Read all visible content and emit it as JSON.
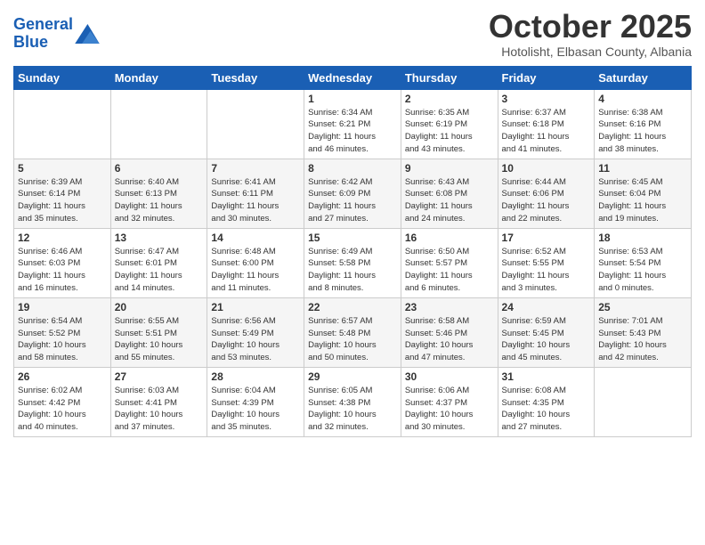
{
  "header": {
    "logo_line1": "General",
    "logo_line2": "Blue",
    "month": "October 2025",
    "location": "Hotolisht, Elbasan County, Albania"
  },
  "weekdays": [
    "Sunday",
    "Monday",
    "Tuesday",
    "Wednesday",
    "Thursday",
    "Friday",
    "Saturday"
  ],
  "weeks": [
    [
      {
        "day": "",
        "info": ""
      },
      {
        "day": "",
        "info": ""
      },
      {
        "day": "",
        "info": ""
      },
      {
        "day": "1",
        "info": "Sunrise: 6:34 AM\nSunset: 6:21 PM\nDaylight: 11 hours\nand 46 minutes."
      },
      {
        "day": "2",
        "info": "Sunrise: 6:35 AM\nSunset: 6:19 PM\nDaylight: 11 hours\nand 43 minutes."
      },
      {
        "day": "3",
        "info": "Sunrise: 6:37 AM\nSunset: 6:18 PM\nDaylight: 11 hours\nand 41 minutes."
      },
      {
        "day": "4",
        "info": "Sunrise: 6:38 AM\nSunset: 6:16 PM\nDaylight: 11 hours\nand 38 minutes."
      }
    ],
    [
      {
        "day": "5",
        "info": "Sunrise: 6:39 AM\nSunset: 6:14 PM\nDaylight: 11 hours\nand 35 minutes."
      },
      {
        "day": "6",
        "info": "Sunrise: 6:40 AM\nSunset: 6:13 PM\nDaylight: 11 hours\nand 32 minutes."
      },
      {
        "day": "7",
        "info": "Sunrise: 6:41 AM\nSunset: 6:11 PM\nDaylight: 11 hours\nand 30 minutes."
      },
      {
        "day": "8",
        "info": "Sunrise: 6:42 AM\nSunset: 6:09 PM\nDaylight: 11 hours\nand 27 minutes."
      },
      {
        "day": "9",
        "info": "Sunrise: 6:43 AM\nSunset: 6:08 PM\nDaylight: 11 hours\nand 24 minutes."
      },
      {
        "day": "10",
        "info": "Sunrise: 6:44 AM\nSunset: 6:06 PM\nDaylight: 11 hours\nand 22 minutes."
      },
      {
        "day": "11",
        "info": "Sunrise: 6:45 AM\nSunset: 6:04 PM\nDaylight: 11 hours\nand 19 minutes."
      }
    ],
    [
      {
        "day": "12",
        "info": "Sunrise: 6:46 AM\nSunset: 6:03 PM\nDaylight: 11 hours\nand 16 minutes."
      },
      {
        "day": "13",
        "info": "Sunrise: 6:47 AM\nSunset: 6:01 PM\nDaylight: 11 hours\nand 14 minutes."
      },
      {
        "day": "14",
        "info": "Sunrise: 6:48 AM\nSunset: 6:00 PM\nDaylight: 11 hours\nand 11 minutes."
      },
      {
        "day": "15",
        "info": "Sunrise: 6:49 AM\nSunset: 5:58 PM\nDaylight: 11 hours\nand 8 minutes."
      },
      {
        "day": "16",
        "info": "Sunrise: 6:50 AM\nSunset: 5:57 PM\nDaylight: 11 hours\nand 6 minutes."
      },
      {
        "day": "17",
        "info": "Sunrise: 6:52 AM\nSunset: 5:55 PM\nDaylight: 11 hours\nand 3 minutes."
      },
      {
        "day": "18",
        "info": "Sunrise: 6:53 AM\nSunset: 5:54 PM\nDaylight: 11 hours\nand 0 minutes."
      }
    ],
    [
      {
        "day": "19",
        "info": "Sunrise: 6:54 AM\nSunset: 5:52 PM\nDaylight: 10 hours\nand 58 minutes."
      },
      {
        "day": "20",
        "info": "Sunrise: 6:55 AM\nSunset: 5:51 PM\nDaylight: 10 hours\nand 55 minutes."
      },
      {
        "day": "21",
        "info": "Sunrise: 6:56 AM\nSunset: 5:49 PM\nDaylight: 10 hours\nand 53 minutes."
      },
      {
        "day": "22",
        "info": "Sunrise: 6:57 AM\nSunset: 5:48 PM\nDaylight: 10 hours\nand 50 minutes."
      },
      {
        "day": "23",
        "info": "Sunrise: 6:58 AM\nSunset: 5:46 PM\nDaylight: 10 hours\nand 47 minutes."
      },
      {
        "day": "24",
        "info": "Sunrise: 6:59 AM\nSunset: 5:45 PM\nDaylight: 10 hours\nand 45 minutes."
      },
      {
        "day": "25",
        "info": "Sunrise: 7:01 AM\nSunset: 5:43 PM\nDaylight: 10 hours\nand 42 minutes."
      }
    ],
    [
      {
        "day": "26",
        "info": "Sunrise: 6:02 AM\nSunset: 4:42 PM\nDaylight: 10 hours\nand 40 minutes."
      },
      {
        "day": "27",
        "info": "Sunrise: 6:03 AM\nSunset: 4:41 PM\nDaylight: 10 hours\nand 37 minutes."
      },
      {
        "day": "28",
        "info": "Sunrise: 6:04 AM\nSunset: 4:39 PM\nDaylight: 10 hours\nand 35 minutes."
      },
      {
        "day": "29",
        "info": "Sunrise: 6:05 AM\nSunset: 4:38 PM\nDaylight: 10 hours\nand 32 minutes."
      },
      {
        "day": "30",
        "info": "Sunrise: 6:06 AM\nSunset: 4:37 PM\nDaylight: 10 hours\nand 30 minutes."
      },
      {
        "day": "31",
        "info": "Sunrise: 6:08 AM\nSunset: 4:35 PM\nDaylight: 10 hours\nand 27 minutes."
      },
      {
        "day": "",
        "info": ""
      }
    ]
  ]
}
